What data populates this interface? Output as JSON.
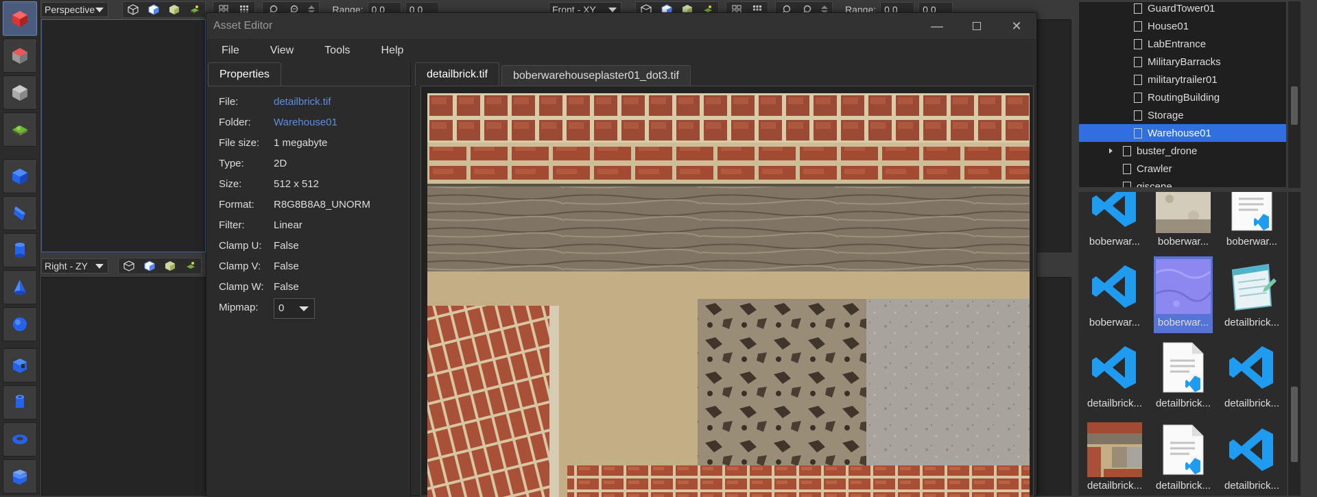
{
  "viewports": {
    "top_left": {
      "view_mode": "Perspective",
      "range_label": "Range:",
      "range_min": "0.0",
      "range_max": "0.0"
    },
    "top_right": {
      "view_mode": "Front - XY",
      "range_label": "Range:",
      "range_min": "0.0",
      "range_max": "0.0"
    },
    "bottom_left": {
      "view_mode": "Right - ZY"
    }
  },
  "asset_editor": {
    "title": "Asset Editor",
    "menu": [
      "File",
      "View",
      "Tools",
      "Help"
    ],
    "properties_tab": "Properties",
    "properties": [
      {
        "key": "File:",
        "value": "detailbrick.tif",
        "link": true
      },
      {
        "key": "Folder:",
        "value": "Warehouse01",
        "link": true
      },
      {
        "key": "File size:",
        "value": "1 megabyte",
        "link": false
      },
      {
        "key": "Type:",
        "value": "2D",
        "link": false
      },
      {
        "key": "Size:",
        "value": "512 x 512",
        "link": false
      },
      {
        "key": "Format:",
        "value": "R8G8B8A8_UNORM",
        "link": false
      },
      {
        "key": "Filter:",
        "value": "Linear",
        "link": false
      },
      {
        "key": "Clamp U:",
        "value": "False",
        "link": false
      },
      {
        "key": "Clamp V:",
        "value": "False",
        "link": false
      },
      {
        "key": "Clamp W:",
        "value": "False",
        "link": false
      }
    ],
    "mipmap_label": "Mipmap:",
    "mipmap_value": "0",
    "preview_tabs": [
      "detailbrick.tif",
      "boberwarehouseplaster01_dot3.tif"
    ]
  },
  "tree": {
    "items": [
      {
        "label": "GuardTower01",
        "indent": 2,
        "selected": false,
        "expandable": false
      },
      {
        "label": "House01",
        "indent": 2,
        "selected": false,
        "expandable": false
      },
      {
        "label": "LabEntrance",
        "indent": 2,
        "selected": false,
        "expandable": false
      },
      {
        "label": "MilitaryBarracks",
        "indent": 2,
        "selected": false,
        "expandable": false
      },
      {
        "label": "militarytrailer01",
        "indent": 2,
        "selected": false,
        "expandable": false
      },
      {
        "label": "RoutingBuilding",
        "indent": 2,
        "selected": false,
        "expandable": false
      },
      {
        "label": "Storage",
        "indent": 2,
        "selected": false,
        "expandable": false
      },
      {
        "label": "Warehouse01",
        "indent": 2,
        "selected": true,
        "expandable": false
      },
      {
        "label": "buster_drone",
        "indent": 1,
        "selected": false,
        "expandable": true
      },
      {
        "label": "Crawler",
        "indent": 1,
        "selected": false,
        "expandable": false
      },
      {
        "label": "giscene",
        "indent": 1,
        "selected": false,
        "expandable": false
      }
    ]
  },
  "assets": [
    {
      "label": "boberwar...",
      "icon": "vscode-icon",
      "selected": false
    },
    {
      "label": "boberwar...",
      "icon": "plaster-texture",
      "selected": false
    },
    {
      "label": "boberwar...",
      "icon": "vscode-document-icon",
      "selected": false
    },
    {
      "label": "boberwar...",
      "icon": "vscode-icon",
      "selected": false
    },
    {
      "label": "boberwar...",
      "icon": "normal-map-texture",
      "selected": true
    },
    {
      "label": "detailbrick...",
      "icon": "notepad-icon",
      "selected": false
    },
    {
      "label": "detailbrick...",
      "icon": "vscode-icon",
      "selected": false
    },
    {
      "label": "detailbrick...",
      "icon": "vscode-document-icon",
      "selected": false
    },
    {
      "label": "detailbrick...",
      "icon": "vscode-icon",
      "selected": false
    },
    {
      "label": "detailbrick...",
      "icon": "brick-texture",
      "selected": false
    },
    {
      "label": "detailbrick...",
      "icon": "vscode-document-icon",
      "selected": false
    },
    {
      "label": "detailbrick...",
      "icon": "vscode-icon",
      "selected": false
    }
  ],
  "colors": {
    "accent": "#2f6fe0",
    "link": "#5b8fe0",
    "primitive_blue": "#2563eb"
  }
}
